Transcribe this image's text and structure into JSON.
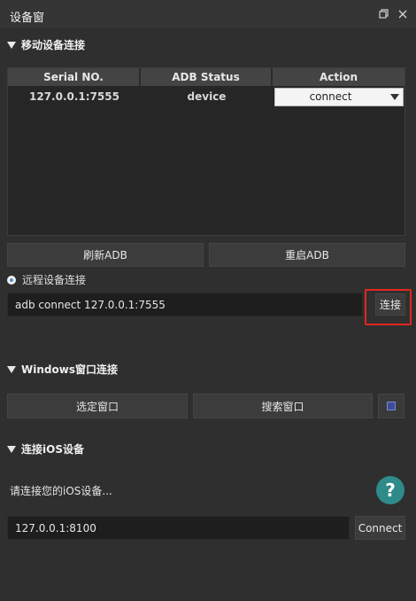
{
  "window": {
    "title": "设备窗"
  },
  "mobile_section": {
    "title": "移动设备连接",
    "table": {
      "headers": [
        "Serial NO.",
        "ADB Status",
        "Action"
      ],
      "rows": [
        {
          "serial": "127.0.0.1:7555",
          "status": "device",
          "action": "connect"
        }
      ]
    },
    "refresh_adb": "刷新ADB",
    "restart_adb": "重启ADB"
  },
  "remote_section": {
    "label": "远程设备连接",
    "input_value": "adb connect 127.0.0.1:7555",
    "connect_button": "连接"
  },
  "windows_section": {
    "title": "Windows窗口连接",
    "select_window": "选定窗口",
    "search_window": "搜索窗口"
  },
  "ios_section": {
    "title": "连接iOS设备",
    "prompt": "请连接您的iOS设备...",
    "input_value": "127.0.0.1:8100",
    "connect_button": "Connect",
    "help_symbol": "?"
  },
  "colors": {
    "background": "#2f2f2f",
    "highlight": "#e0281e",
    "help_icon": "#2f8a8a"
  }
}
